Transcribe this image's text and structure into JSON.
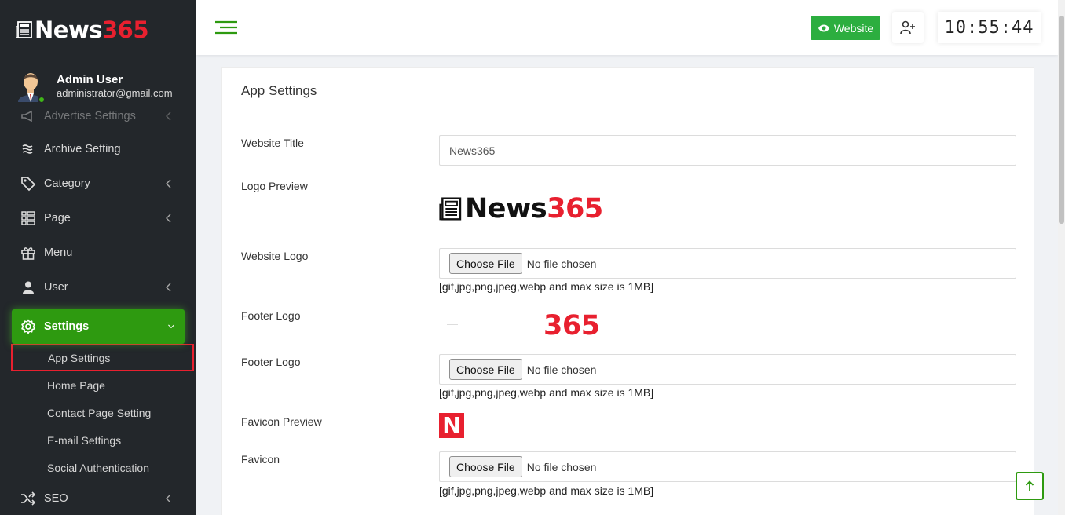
{
  "brand": {
    "name_text": "News",
    "name_num": "365"
  },
  "user": {
    "name": "Admin User",
    "email": "administrator@gmail.com"
  },
  "sidebar": {
    "items": [
      {
        "label": "Advertise Settings",
        "icon": "megaphone-icon"
      },
      {
        "label": "Archive Setting",
        "icon": "waves-icon"
      },
      {
        "label": "Category",
        "icon": "tag-icon"
      },
      {
        "label": "Page",
        "icon": "page-list-icon"
      },
      {
        "label": "Menu",
        "icon": "gift-icon"
      },
      {
        "label": "User",
        "icon": "user-icon"
      },
      {
        "label": "Settings",
        "icon": "gear-icon"
      },
      {
        "label": "SEO",
        "icon": "shuffle-icon"
      }
    ],
    "settings_sub": [
      {
        "label": "App Settings"
      },
      {
        "label": "Home Page"
      },
      {
        "label": "Contact Page Setting"
      },
      {
        "label": "E-mail Settings"
      },
      {
        "label": "Social Authentication"
      }
    ]
  },
  "topbar": {
    "website_label": "Website",
    "clock": "10:55:44"
  },
  "card": {
    "title": "App Settings",
    "website_title_label": "Website Title",
    "website_title_value": "News365",
    "logo_preview_label": "Logo Preview",
    "logo_preview_text": "News",
    "logo_preview_num": "365",
    "website_logo_label": "Website Logo",
    "footer_logo_preview_label": "Footer Logo",
    "footer_logo_preview_num": "365",
    "footer_logo_label": "Footer Logo",
    "favicon_preview_label": "Favicon Preview",
    "favicon_letter": "N",
    "favicon_label": "Favicon",
    "choose_file": "Choose File",
    "no_file": "No file chosen",
    "hint": "[gif,jpg,png,jpeg,webp and max size is 1MB]"
  },
  "colors": {
    "accent_green": "#2e9a10",
    "brand_red": "#e8202f",
    "sidebar_bg": "#23272b"
  }
}
